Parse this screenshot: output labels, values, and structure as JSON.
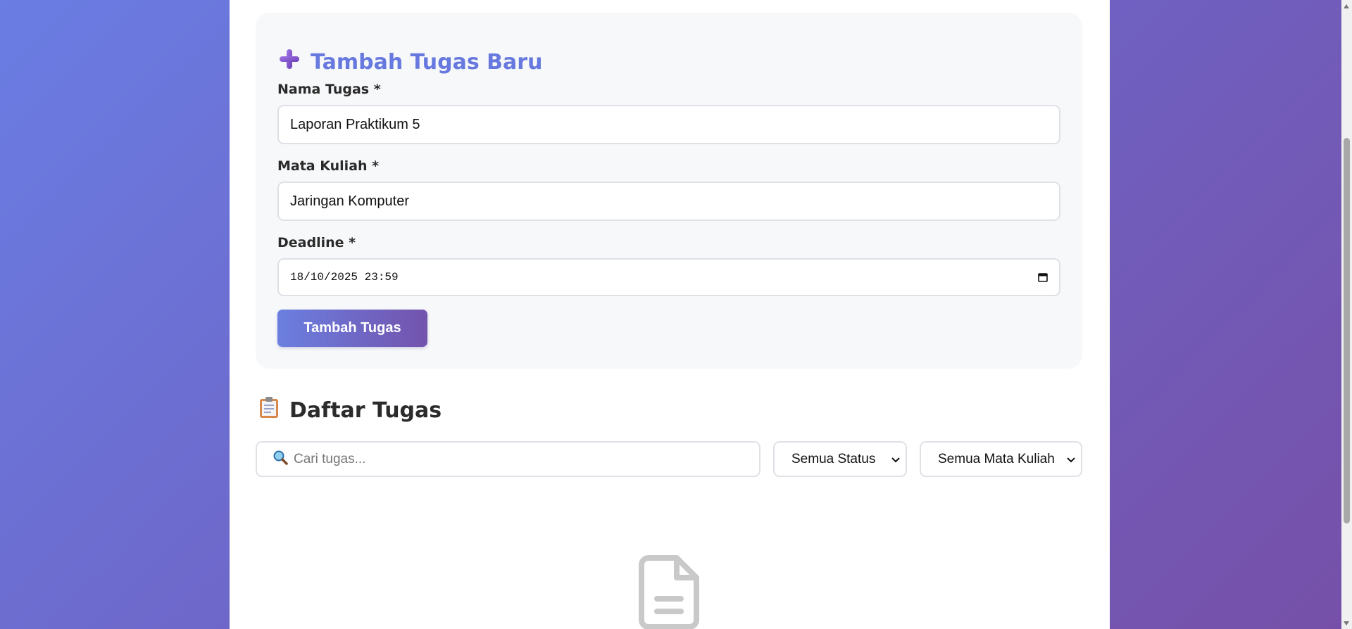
{
  "form": {
    "title": "Tambah Tugas Baru",
    "title_icon": "plus-icon",
    "fields": [
      {
        "label": "Nama Tugas *",
        "value": "Laporan Praktikum 5"
      },
      {
        "label": "Mata Kuliah *",
        "value": "Jaringan Komputer"
      },
      {
        "label": "Deadline *",
        "value": "18/10/2025 23:59"
      }
    ],
    "submit_label": "Tambah Tugas"
  },
  "task_list": {
    "title": "Daftar Tugas",
    "title_icon": "clipboard-icon",
    "search_placeholder": "Cari tugas...",
    "search_icon": "search-icon",
    "status_filter": "Semua Status",
    "course_filter": "Semua Mata Kuliah",
    "empty_icon": "document-icon"
  },
  "colors": {
    "accent": "#6779de",
    "button_gradient_start": "#6b7fe0",
    "button_gradient_end": "#7353ad",
    "background_start": "#6a7de3",
    "background_end": "#7650a8"
  }
}
